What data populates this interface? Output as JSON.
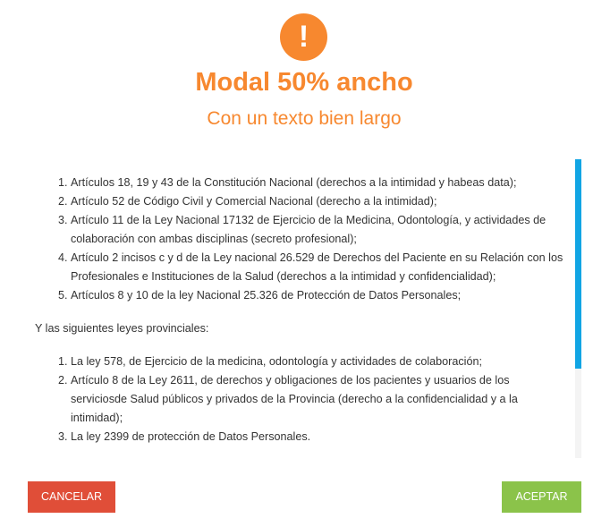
{
  "modal": {
    "icon_glyph": "!",
    "icon_name": "exclamation-icon",
    "title": "Modal 50% ancho",
    "subtitle": "Con un texto bien largo",
    "accent_color": "#f7882f",
    "national_laws": [
      "Artículos 18, 19 y 43 de la Constitución Nacional (derechos a la intimidad y habeas data);",
      "Artículo 52 de Código Civil y Comercial Nacional (derecho a la intimidad);",
      "Artículo 11 de la Ley Nacional 17132 de Ejercicio de la Medicina, Odontología, y actividades de colaboración con ambas disciplinas (secreto profesional);",
      "Artículo 2 incisos c y d de la Ley nacional 26.529 de Derechos del Paciente en su Relación con los Profesionales e Instituciones de la Salud (derechos a la intimidad y confidencialidad);",
      "Artículos 8 y 10 de la ley Nacional 25.326 de Protección de Datos Personales;"
    ],
    "provincial_intro": "Y las siguientes leyes provinciales:",
    "provincial_laws": [
      "La ley 578, de Ejercicio de la medicina, odontología y actividades de colaboración;",
      "Artículo 8 de la Ley 2611, de derechos y obligaciones de los pacientes y usuarios de los serviciosde Salud públicos y privados de la Provincia (derecho a la confidencialidad y a la intimidad);",
      "La ley 2399 de protección de Datos Personales."
    ],
    "cancel_label": "CANCELAR",
    "accept_label": "ACEPTAR",
    "cancel_color": "#e04e38",
    "accept_color": "#8bc34a",
    "scrollbar_color": "#11a5e4"
  }
}
